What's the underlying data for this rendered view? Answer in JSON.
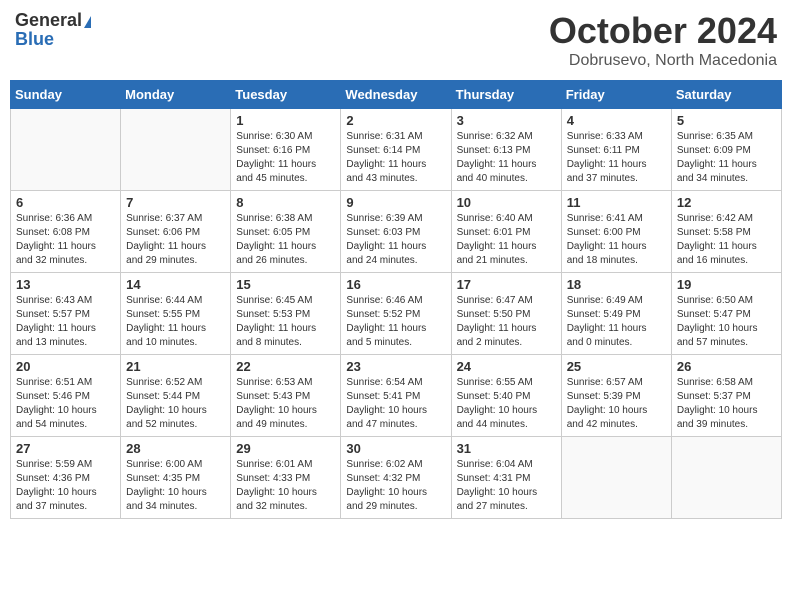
{
  "header": {
    "logo_general": "General",
    "logo_blue": "Blue",
    "month_title": "October 2024",
    "subtitle": "Dobrusevo, North Macedonia"
  },
  "days_of_week": [
    "Sunday",
    "Monday",
    "Tuesday",
    "Wednesday",
    "Thursday",
    "Friday",
    "Saturday"
  ],
  "weeks": [
    [
      {
        "day": "",
        "info": ""
      },
      {
        "day": "",
        "info": ""
      },
      {
        "day": "1",
        "info": "Sunrise: 6:30 AM\nSunset: 6:16 PM\nDaylight: 11 hours and 45 minutes."
      },
      {
        "day": "2",
        "info": "Sunrise: 6:31 AM\nSunset: 6:14 PM\nDaylight: 11 hours and 43 minutes."
      },
      {
        "day": "3",
        "info": "Sunrise: 6:32 AM\nSunset: 6:13 PM\nDaylight: 11 hours and 40 minutes."
      },
      {
        "day": "4",
        "info": "Sunrise: 6:33 AM\nSunset: 6:11 PM\nDaylight: 11 hours and 37 minutes."
      },
      {
        "day": "5",
        "info": "Sunrise: 6:35 AM\nSunset: 6:09 PM\nDaylight: 11 hours and 34 minutes."
      }
    ],
    [
      {
        "day": "6",
        "info": "Sunrise: 6:36 AM\nSunset: 6:08 PM\nDaylight: 11 hours and 32 minutes."
      },
      {
        "day": "7",
        "info": "Sunrise: 6:37 AM\nSunset: 6:06 PM\nDaylight: 11 hours and 29 minutes."
      },
      {
        "day": "8",
        "info": "Sunrise: 6:38 AM\nSunset: 6:05 PM\nDaylight: 11 hours and 26 minutes."
      },
      {
        "day": "9",
        "info": "Sunrise: 6:39 AM\nSunset: 6:03 PM\nDaylight: 11 hours and 24 minutes."
      },
      {
        "day": "10",
        "info": "Sunrise: 6:40 AM\nSunset: 6:01 PM\nDaylight: 11 hours and 21 minutes."
      },
      {
        "day": "11",
        "info": "Sunrise: 6:41 AM\nSunset: 6:00 PM\nDaylight: 11 hours and 18 minutes."
      },
      {
        "day": "12",
        "info": "Sunrise: 6:42 AM\nSunset: 5:58 PM\nDaylight: 11 hours and 16 minutes."
      }
    ],
    [
      {
        "day": "13",
        "info": "Sunrise: 6:43 AM\nSunset: 5:57 PM\nDaylight: 11 hours and 13 minutes."
      },
      {
        "day": "14",
        "info": "Sunrise: 6:44 AM\nSunset: 5:55 PM\nDaylight: 11 hours and 10 minutes."
      },
      {
        "day": "15",
        "info": "Sunrise: 6:45 AM\nSunset: 5:53 PM\nDaylight: 11 hours and 8 minutes."
      },
      {
        "day": "16",
        "info": "Sunrise: 6:46 AM\nSunset: 5:52 PM\nDaylight: 11 hours and 5 minutes."
      },
      {
        "day": "17",
        "info": "Sunrise: 6:47 AM\nSunset: 5:50 PM\nDaylight: 11 hours and 2 minutes."
      },
      {
        "day": "18",
        "info": "Sunrise: 6:49 AM\nSunset: 5:49 PM\nDaylight: 11 hours and 0 minutes."
      },
      {
        "day": "19",
        "info": "Sunrise: 6:50 AM\nSunset: 5:47 PM\nDaylight: 10 hours and 57 minutes."
      }
    ],
    [
      {
        "day": "20",
        "info": "Sunrise: 6:51 AM\nSunset: 5:46 PM\nDaylight: 10 hours and 54 minutes."
      },
      {
        "day": "21",
        "info": "Sunrise: 6:52 AM\nSunset: 5:44 PM\nDaylight: 10 hours and 52 minutes."
      },
      {
        "day": "22",
        "info": "Sunrise: 6:53 AM\nSunset: 5:43 PM\nDaylight: 10 hours and 49 minutes."
      },
      {
        "day": "23",
        "info": "Sunrise: 6:54 AM\nSunset: 5:41 PM\nDaylight: 10 hours and 47 minutes."
      },
      {
        "day": "24",
        "info": "Sunrise: 6:55 AM\nSunset: 5:40 PM\nDaylight: 10 hours and 44 minutes."
      },
      {
        "day": "25",
        "info": "Sunrise: 6:57 AM\nSunset: 5:39 PM\nDaylight: 10 hours and 42 minutes."
      },
      {
        "day": "26",
        "info": "Sunrise: 6:58 AM\nSunset: 5:37 PM\nDaylight: 10 hours and 39 minutes."
      }
    ],
    [
      {
        "day": "27",
        "info": "Sunrise: 5:59 AM\nSunset: 4:36 PM\nDaylight: 10 hours and 37 minutes."
      },
      {
        "day": "28",
        "info": "Sunrise: 6:00 AM\nSunset: 4:35 PM\nDaylight: 10 hours and 34 minutes."
      },
      {
        "day": "29",
        "info": "Sunrise: 6:01 AM\nSunset: 4:33 PM\nDaylight: 10 hours and 32 minutes."
      },
      {
        "day": "30",
        "info": "Sunrise: 6:02 AM\nSunset: 4:32 PM\nDaylight: 10 hours and 29 minutes."
      },
      {
        "day": "31",
        "info": "Sunrise: 6:04 AM\nSunset: 4:31 PM\nDaylight: 10 hours and 27 minutes."
      },
      {
        "day": "",
        "info": ""
      },
      {
        "day": "",
        "info": ""
      }
    ]
  ]
}
